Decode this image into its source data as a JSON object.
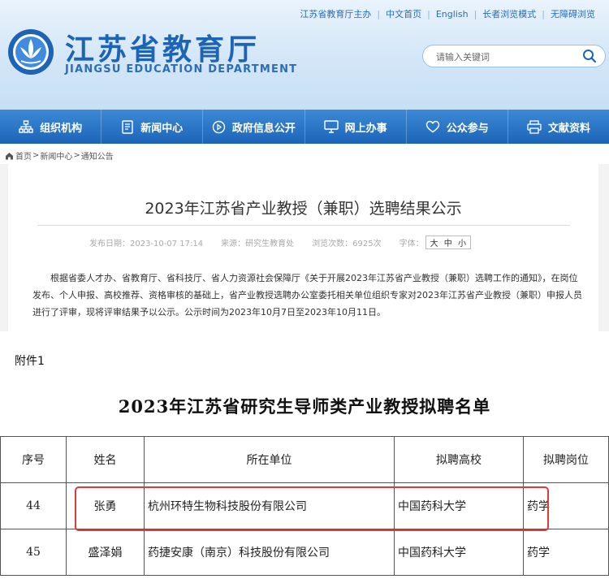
{
  "header": {
    "top_links": [
      "江苏省教育厅主办",
      "中文首页",
      "English",
      "长者浏览模式",
      "无障碍浏览"
    ],
    "title_cn": "江苏省教育厅",
    "title_en": "JIANGSU EDUCATION DEPARTMENT",
    "search_placeholder": "请输入关键词"
  },
  "nav": [
    "组织机构",
    "新闻中心",
    "政府信息公开",
    "网上办事",
    "公众参与",
    "文献资料"
  ],
  "breadcrumb": [
    "首页",
    "新闻中心",
    "通知公告"
  ],
  "article": {
    "title": "2023年江苏省产业教授（兼职）选聘结果公示",
    "publish_date": "发布日期：2023-10-07 17:14",
    "source": "来源：研究生教育处",
    "views": "浏览次数：6925次",
    "fontsize_label": "字体：",
    "fontsize_options": [
      "大",
      "中",
      "小"
    ],
    "body": "根据省委人才办、省教育厅、省科技厅、省人力资源社会保障厅《关于开展2023年江苏省产业教授（兼职）选聘工作的通知》，在岗位发布、个人申报、高校推荐、资格审核的基础上，省产业教授选聘办公室委托相关单位组织专家对2023年江苏省产业教授（兼职）申报人员进行了评审，现将评审结果予以公示。公示时间为2023年10月7日至2023年10月11日。"
  },
  "attachment": {
    "label": "附件1",
    "list_title": "2023年江苏省研究生导师类产业教授拟聘名单",
    "columns": [
      "序号",
      "姓名",
      "所在单位",
      "拟聘高校",
      "拟聘岗位"
    ],
    "rows": [
      [
        "44",
        "张勇",
        "杭州环特生物科技股份有限公司",
        "中国药科大学",
        "药学"
      ],
      [
        "45",
        "盛泽娟",
        "药捷安康（南京）科技股份有限公司",
        "中国药科大学",
        "药学"
      ]
    ]
  },
  "colors": {
    "brand_blue": "#1d64b5",
    "nav_blue": "#2a72c6",
    "highlight_red": "#e03a3a"
  }
}
